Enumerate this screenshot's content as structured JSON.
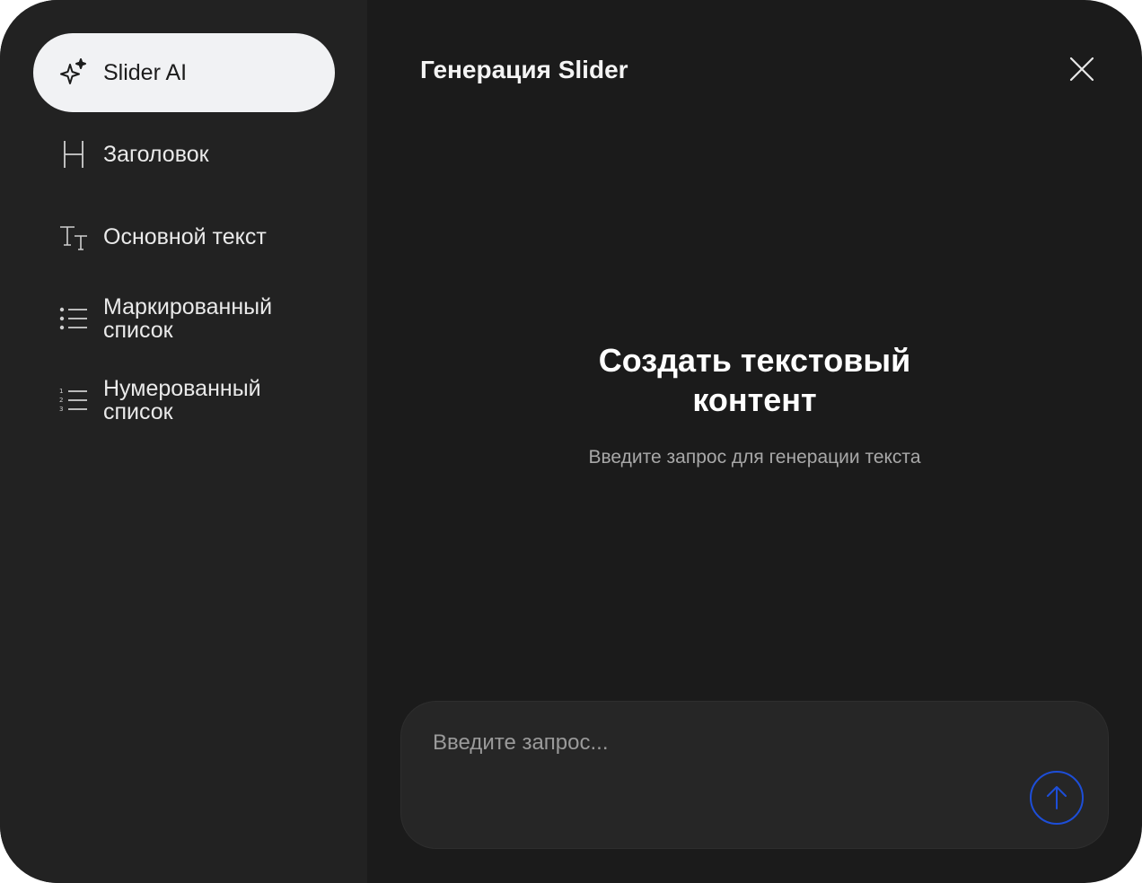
{
  "sidebar": {
    "items": [
      {
        "label": "Slider AI",
        "icon": "sparkle-icon"
      },
      {
        "label": "Заголовок",
        "icon": "heading-icon"
      },
      {
        "label": "Основной текст",
        "icon": "text-size-icon"
      },
      {
        "label": "Маркированный\nсписок",
        "icon": "bullet-list-icon"
      },
      {
        "label": "Нумерованный\nсписок",
        "icon": "numbered-list-icon"
      }
    ]
  },
  "main": {
    "title": "Генерация Slider",
    "empty_state": {
      "title": "Создать текстовый\nконтент",
      "subtitle": "Введите запрос для генерации текста"
    },
    "prompt": {
      "value": "",
      "placeholder": "Введите запрос..."
    }
  },
  "colors": {
    "window_bg": "#1b1b1b",
    "sidebar_bg": "#222222",
    "active_item_bg": "#f1f2f4",
    "send_button_accent": "#1d4ed8"
  }
}
